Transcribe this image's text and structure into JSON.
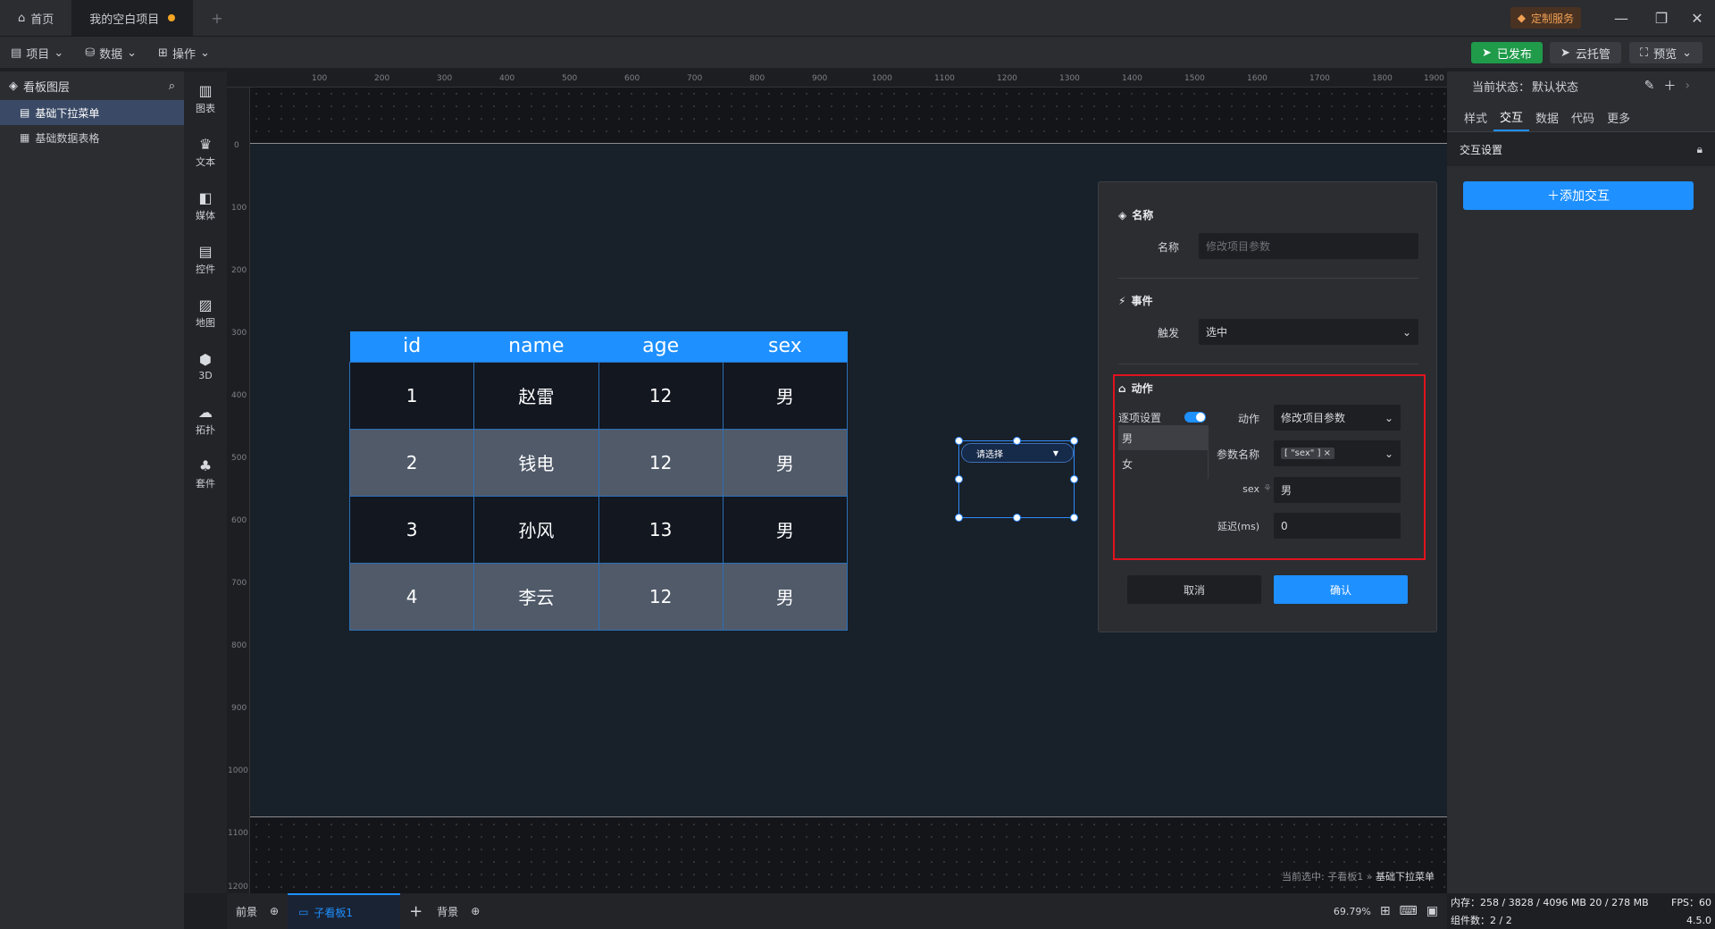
{
  "titlebar": {
    "tabs": [
      {
        "label": "首页"
      },
      {
        "label": "我的空白项目"
      }
    ],
    "custom_service": "定制服务",
    "window": {
      "minimize": "—",
      "restore": "❐",
      "close": "✕"
    }
  },
  "toolbar": {
    "menus": [
      "项目",
      "数据",
      "操作"
    ],
    "published": "已发布",
    "cloud_hosting": "云托管",
    "preview": "预览"
  },
  "layers": {
    "title": "看板图层",
    "items": [
      {
        "label": "基础下拉菜单"
      },
      {
        "label": "基础数据表格"
      }
    ]
  },
  "components": [
    "图表",
    "文本",
    "媒体",
    "控件",
    "地图",
    "3D",
    "拓扑",
    "套件"
  ],
  "ruler": {
    "top": [
      "100",
      "200",
      "300",
      "400",
      "500",
      "600",
      "700",
      "800",
      "900",
      "1000",
      "1100",
      "1200",
      "1300",
      "1400",
      "1500",
      "1600",
      "1700",
      "1800",
      "1900"
    ],
    "left": [
      "0",
      "100",
      "200",
      "300",
      "400",
      "500",
      "600",
      "700",
      "800",
      "900",
      "1000",
      "1100",
      "1200"
    ]
  },
  "table": {
    "headers": [
      "id",
      "name",
      "age",
      "sex"
    ],
    "rows": [
      [
        "1",
        "赵雷",
        "12",
        "男"
      ],
      [
        "2",
        "钱电",
        "12",
        "男"
      ],
      [
        "3",
        "孙风",
        "13",
        "男"
      ],
      [
        "4",
        "李云",
        "12",
        "男"
      ]
    ]
  },
  "dropdown": {
    "placeholder": "请选择",
    "arrow": "▼"
  },
  "modal": {
    "name_section": "名称",
    "name_label": "名称",
    "name_placeholder": "修改项目参数",
    "event_section": "事件",
    "trigger_label": "触发",
    "trigger_value": "选中",
    "action_section": "动作",
    "per_item": "逐项设置",
    "options": [
      "男",
      "女"
    ],
    "action_label": "动作",
    "action_value": "修改项目参数",
    "param_label": "参数名称",
    "param_tag": "[ \"sex\" ]",
    "sex_label": "sex",
    "sex_value": "男",
    "delay_label": "延迟(ms)",
    "delay_value": "0",
    "cancel": "取消",
    "confirm": "确认"
  },
  "right_panel": {
    "state_label": "当前状态：",
    "state_value": "默认状态",
    "tabs": [
      "样式",
      "交互",
      "数据",
      "代码",
      "更多"
    ],
    "section": "交互设置",
    "add_button": "添加交互"
  },
  "canvas_status": {
    "prefix": "当前选中:",
    "board": "子看板1",
    "sep": "»",
    "selected": "基础下拉菜单"
  },
  "bottom": {
    "foreground": "前景",
    "subboard": "子看板1",
    "background": "背景",
    "add": "+",
    "zoom": "69.79%"
  },
  "status": {
    "memory": "内存：258 / 3828 / 4096 MB 20 / 278 MB",
    "fps": "FPS：60",
    "components": "组件数：2 / 2",
    "version": "4.5.0"
  },
  "colors": {
    "accent": "#1e90ff",
    "publish": "#1f9b4a",
    "highlight": "#e0131d"
  }
}
